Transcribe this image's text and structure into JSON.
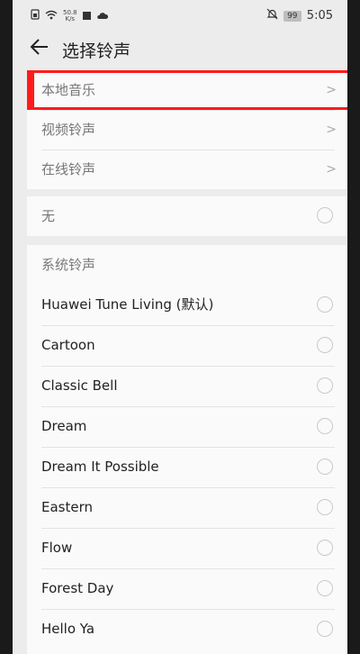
{
  "status": {
    "speed_top": "50.8",
    "speed_unit": "K/s",
    "battery": "99",
    "time": "5:05"
  },
  "header": {
    "title": "选择铃声"
  },
  "sources": [
    {
      "label": "本地音乐"
    },
    {
      "label": "视频铃声"
    },
    {
      "label": "在线铃声"
    }
  ],
  "none_option": {
    "label": "无"
  },
  "system": {
    "section_title": "系统铃声",
    "items": [
      {
        "label": "Huawei Tune Living (默认)"
      },
      {
        "label": "Cartoon"
      },
      {
        "label": "Classic Bell"
      },
      {
        "label": "Dream"
      },
      {
        "label": "Dream It Possible"
      },
      {
        "label": "Eastern"
      },
      {
        "label": "Flow"
      },
      {
        "label": "Forest Day"
      },
      {
        "label": "Hello Ya"
      }
    ]
  },
  "colors": {
    "highlight": "#ff1b1b",
    "background": "#ececec"
  }
}
